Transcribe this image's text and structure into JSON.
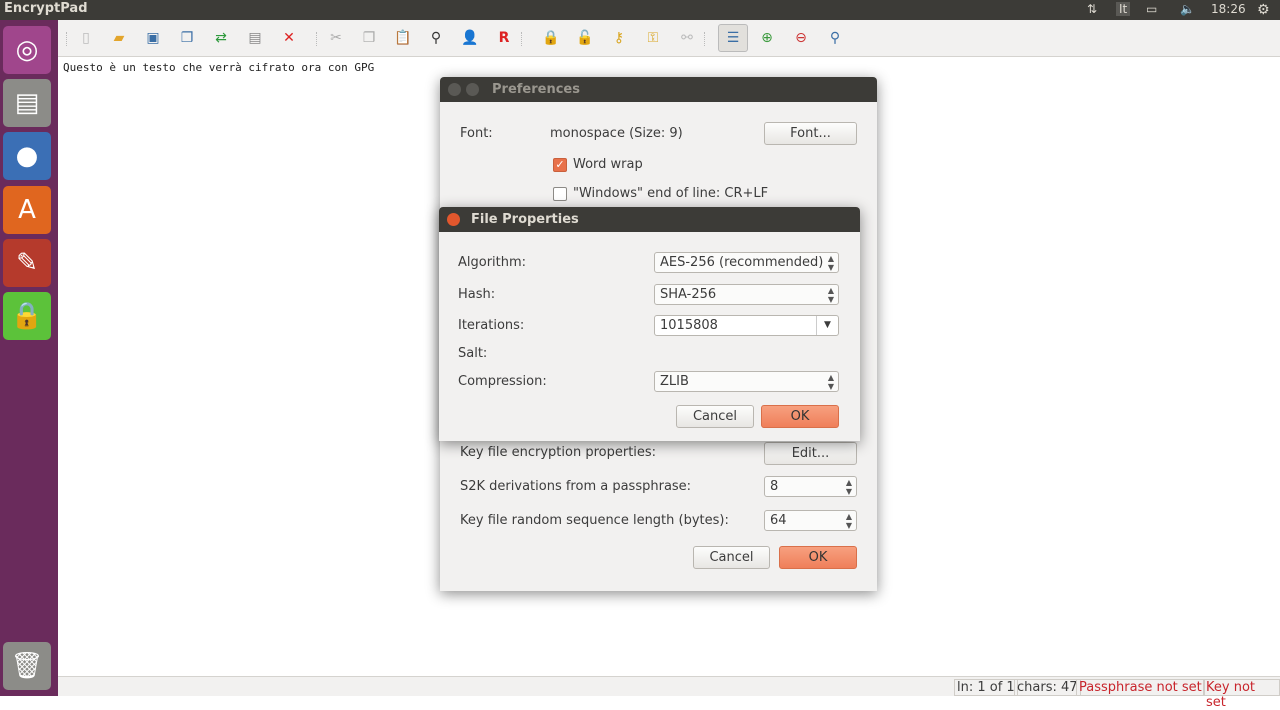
{
  "topbar": {
    "app_title": "EncryptPad",
    "keyboard": "It",
    "time": "18:26"
  },
  "launcher": {
    "items": [
      "ubuntu-dash",
      "files",
      "firefox",
      "software-center",
      "system-settings",
      "encryptpad",
      "trash"
    ]
  },
  "toolbar": {
    "icons": [
      "new-file",
      "open",
      "save",
      "save-as",
      "encryption",
      "file-properties",
      "close",
      "cut",
      "copy",
      "paste",
      "find",
      "user",
      "r",
      "lock",
      "unlock",
      "key-chain",
      "key",
      "unlink",
      "word-wrap",
      "zoom-in",
      "zoom-out",
      "zoom-reset"
    ]
  },
  "editor": {
    "text": "Questo è un testo che verrà cifrato ora con GPG"
  },
  "status": {
    "line": "ln: 1 of 1",
    "chars": "chars: 47",
    "passphrase": "Passphrase not set",
    "key": "Key not set"
  },
  "preferences": {
    "title": "Preferences",
    "font_label": "Font:",
    "font_value": "monospace (Size: 9)",
    "font_button": "Font...",
    "word_wrap": "Word wrap",
    "word_wrap_checked": true,
    "eol": "\"Windows\" end of line: CR+LF",
    "eol_checked": false,
    "key_file_label": "Key file encryption properties:",
    "edit_button": "Edit...",
    "s2k_label": "S2K derivations from a passphrase:",
    "s2k_value": "8",
    "random_len_label": "Key file random sequence length (bytes):",
    "random_len_value": "64",
    "cancel": "Cancel",
    "ok": "OK"
  },
  "file_properties": {
    "title": "File Properties",
    "algorithm_label": "Algorithm:",
    "algorithm_value": "AES-256 (recommended)",
    "hash_label": "Hash:",
    "hash_value": "SHA-256",
    "iterations_label": "Iterations:",
    "iterations_value": "1015808",
    "salt_label": "Salt:",
    "compression_label": "Compression:",
    "compression_value": "ZLIB",
    "cancel": "Cancel",
    "ok": "OK"
  }
}
